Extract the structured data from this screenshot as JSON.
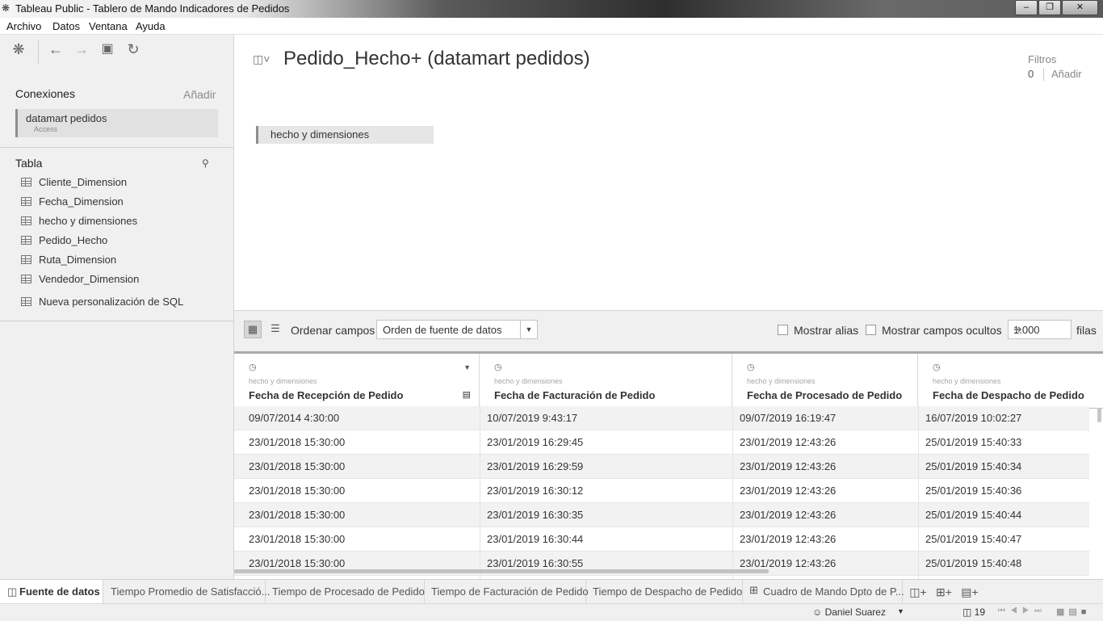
{
  "window": {
    "title": "Tableau Public - Tablero de Mando Indicadores de Pedidos",
    "minimize": "–",
    "maximize": "❐",
    "close": "✕"
  },
  "menu": [
    "Archivo",
    "Datos",
    "Ventana",
    "Ayuda"
  ],
  "left_panel": {
    "connections_title": "Conexiones",
    "connections_add": "Añadir",
    "connection": {
      "name": "datamart pedidos",
      "type": "Access"
    },
    "table_title": "Tabla",
    "tables": [
      "Cliente_Dimension",
      "Fecha_Dimension",
      "hecho y dimensiones",
      "Pedido_Hecho",
      "Ruta_Dimension",
      "Vendedor_Dimension"
    ],
    "custom_sql": "Nueva personalización de SQL"
  },
  "canvas": {
    "datasource_title": "Pedido_Hecho+ (datamart pedidos)",
    "filters_label": "Filtros",
    "filters_count": "0",
    "filters_add": "Añadir",
    "table_pill": "hecho y dimensiones"
  },
  "grid_toolbar": {
    "sort_label": "Ordenar campos",
    "sort_value": "Orden de fuente de datos",
    "show_alias": "Mostrar alias",
    "show_hidden": "Mostrar campos ocultos",
    "rows_value": "1.000",
    "rows_label": "filas"
  },
  "grid": {
    "columns": [
      {
        "source": "hecho y dimensiones",
        "name": "Fecha de Recepción de Pedido"
      },
      {
        "source": "hecho y dimensiones",
        "name": "Fecha de Facturación de Pedido"
      },
      {
        "source": "hecho y dimensiones",
        "name": "Fecha de Procesado de Pedido"
      },
      {
        "source": "hecho y dimensiones",
        "name": "Fecha de Despacho de Pedido"
      }
    ],
    "rows": [
      [
        "09/07/2014 4:30:00",
        "10/07/2019 9:43:17",
        "09/07/2019 16:19:47",
        "16/07/2019 10:02:27"
      ],
      [
        "23/01/2018 15:30:00",
        "23/01/2019 16:29:45",
        "23/01/2019 12:43:26",
        "25/01/2019 15:40:33"
      ],
      [
        "23/01/2018 15:30:00",
        "23/01/2019 16:29:59",
        "23/01/2019 12:43:26",
        "25/01/2019 15:40:34"
      ],
      [
        "23/01/2018 15:30:00",
        "23/01/2019 16:30:12",
        "23/01/2019 12:43:26",
        "25/01/2019 15:40:36"
      ],
      [
        "23/01/2018 15:30:00",
        "23/01/2019 16:30:35",
        "23/01/2019 12:43:26",
        "25/01/2019 15:40:44"
      ],
      [
        "23/01/2018 15:30:00",
        "23/01/2019 16:30:44",
        "23/01/2019 12:43:26",
        "25/01/2019 15:40:47"
      ],
      [
        "23/01/2018 15:30:00",
        "23/01/2019 16:30:55",
        "23/01/2019 12:43:26",
        "25/01/2019 15:40:48"
      ]
    ]
  },
  "tabs": [
    "Fuente de datos",
    "Tiempo Promedio de Satisfacció...",
    "Tiempo de Procesado de Pedido",
    "Tiempo de Facturación de Pedido",
    "Tiempo de Despacho de Pedido",
    "Cuadro de Mando Dpto de P..."
  ],
  "status": {
    "user": "Daniel Suarez",
    "sheet_count": "19"
  }
}
